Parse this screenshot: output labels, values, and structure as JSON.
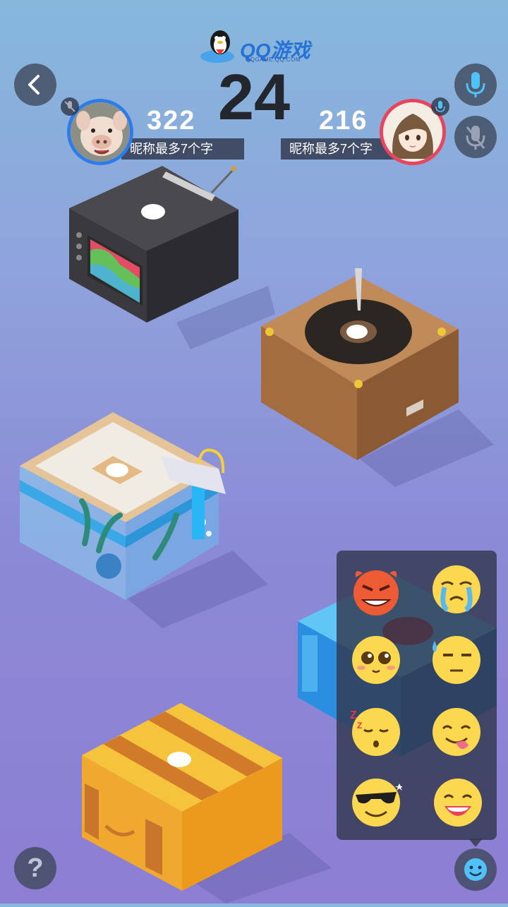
{
  "header": {
    "logo_text": "QQ游戏",
    "logo_sub": "QQGAME.QQ.COM",
    "timer": "24"
  },
  "players": {
    "left": {
      "score": "322",
      "name": "昵称最多7个字"
    },
    "right": {
      "score": "216",
      "name": "昵称最多7个字"
    }
  },
  "help": {
    "label": "?"
  },
  "emojis": [
    "devil-emoji",
    "crying-emoji",
    "adoring-emoji",
    "sweat-emoji",
    "sleepy-emoji",
    "tongue-emoji",
    "sunglasses-emoji",
    "laughing-emoji"
  ]
}
